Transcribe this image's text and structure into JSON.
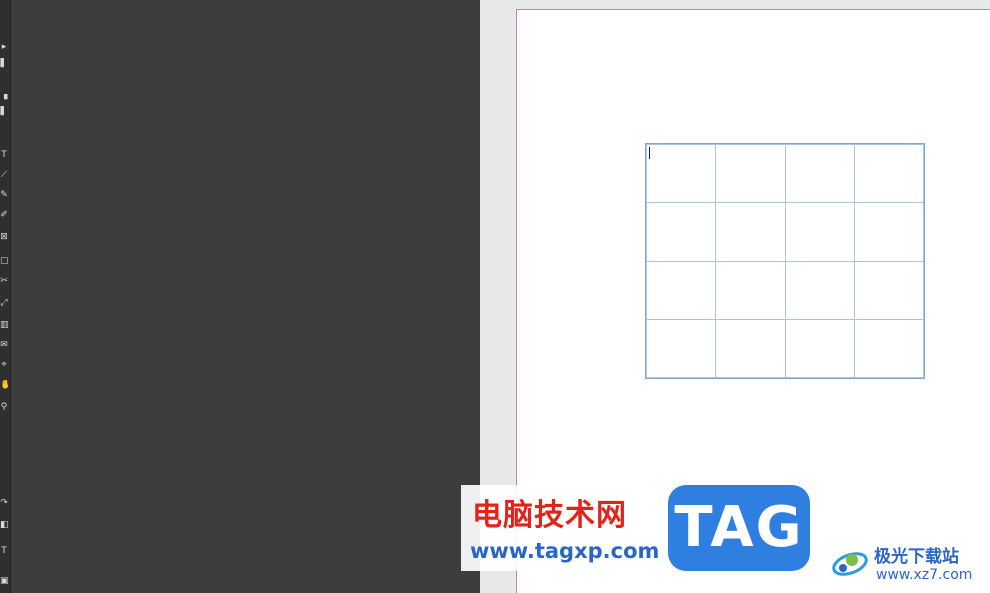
{
  "toolbar": {
    "tools": [
      {
        "name": "selection-tool",
        "glyph": "▸"
      },
      {
        "name": "direct-selection-tool",
        "glyph": "▌"
      },
      {
        "name": "page-tool",
        "glyph": "▗"
      },
      {
        "name": "gap-tool",
        "glyph": "▌"
      },
      {
        "name": "type-tool",
        "glyph": "T"
      },
      {
        "name": "line-tool",
        "glyph": "⟋"
      },
      {
        "name": "pen-tool",
        "glyph": "✎"
      },
      {
        "name": "pencil-tool",
        "glyph": "✐"
      },
      {
        "name": "rectangle-frame-tool",
        "glyph": "⊠"
      },
      {
        "name": "rectangle-tool",
        "glyph": "▢"
      },
      {
        "name": "scissors-tool",
        "glyph": "✂"
      },
      {
        "name": "free-transform-tool",
        "glyph": "⤢"
      },
      {
        "name": "gradient-tool",
        "glyph": "▥"
      },
      {
        "name": "note-tool",
        "glyph": "✉"
      },
      {
        "name": "eyedropper-tool",
        "glyph": "⌖"
      },
      {
        "name": "hand-tool",
        "glyph": "✋"
      },
      {
        "name": "zoom-tool",
        "glyph": "⚲"
      },
      {
        "name": "swap-colors",
        "glyph": "↷"
      },
      {
        "name": "fill-stroke",
        "glyph": "◧"
      },
      {
        "name": "formatting-affects-text",
        "glyph": "T"
      },
      {
        "name": "screen-mode",
        "glyph": "▣"
      }
    ]
  },
  "document": {
    "table": {
      "rows": [
        [
          "",
          "",
          "",
          ""
        ],
        [
          "",
          "",
          "",
          ""
        ],
        [
          "",
          "",
          "",
          ""
        ],
        [
          "",
          "",
          "",
          ""
        ]
      ]
    },
    "colors": {
      "margin_guide": "#c77bc7",
      "table_stroke": "#a9c6e0"
    }
  },
  "watermark": {
    "cn_title": "电脑技术网",
    "url": "www.tagxp.com",
    "tag": "TAG",
    "right_cn": "极光下载站",
    "right_url": "www.xz7.com"
  }
}
